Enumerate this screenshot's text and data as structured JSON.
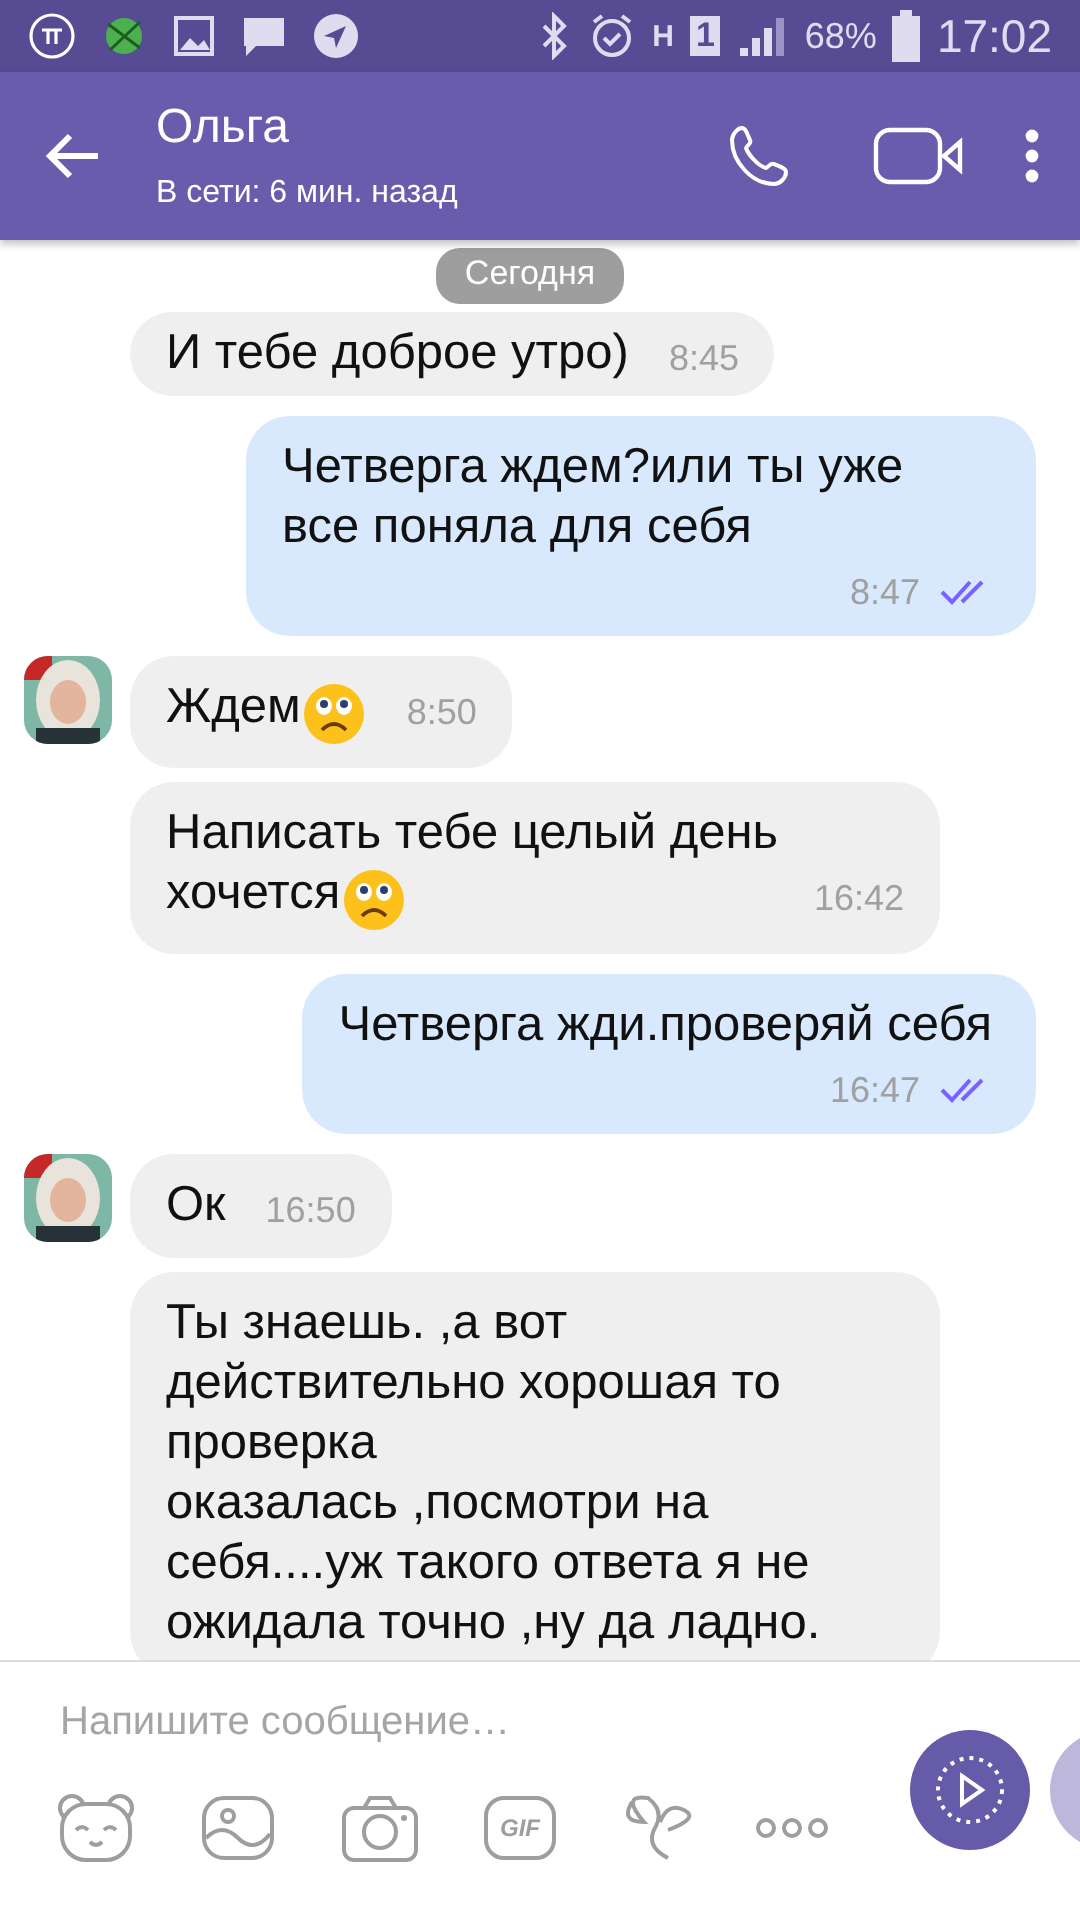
{
  "status_bar": {
    "network": "H",
    "sim": "1",
    "battery": "68%",
    "time": "17:02"
  },
  "header": {
    "title": "Ольга",
    "subtitle": "В сети: 6 мин. назад"
  },
  "date_badge": "Сегодня",
  "messages": [
    {
      "kind": "incoming",
      "avatar": false,
      "text": "И тебе доброе утро)",
      "time": "8:45",
      "sad_emoji": false
    },
    {
      "kind": "outgoing",
      "text": "Четверга ждем?или ты уже все поняла для себя",
      "time": "8:47",
      "seen": true
    },
    {
      "kind": "incoming",
      "avatar": true,
      "text": "Ждем",
      "time": "8:50",
      "sad_emoji": true
    },
    {
      "kind": "incoming",
      "avatar": false,
      "text": "Написать тебе целый день хочется",
      "time": "16:42",
      "sad_emoji": true
    },
    {
      "kind": "outgoing",
      "text": "Четверга жди.проверяй себя",
      "time": "16:47",
      "seen": true
    },
    {
      "kind": "incoming",
      "avatar": true,
      "text": "Ок",
      "time": "16:50",
      "sad_emoji": false
    },
    {
      "kind": "incoming",
      "avatar": false,
      "text": "Ты знаешь. ,а вот действительно хорошая то проверка\nоказалась ,посмотри на себя....уж такого ответа я не ожидала точно ,ну да ладно.",
      "sad_emoji": false
    }
  ],
  "composer": {
    "placeholder": "Напишите сообщение…",
    "gif_label": "GIF"
  }
}
